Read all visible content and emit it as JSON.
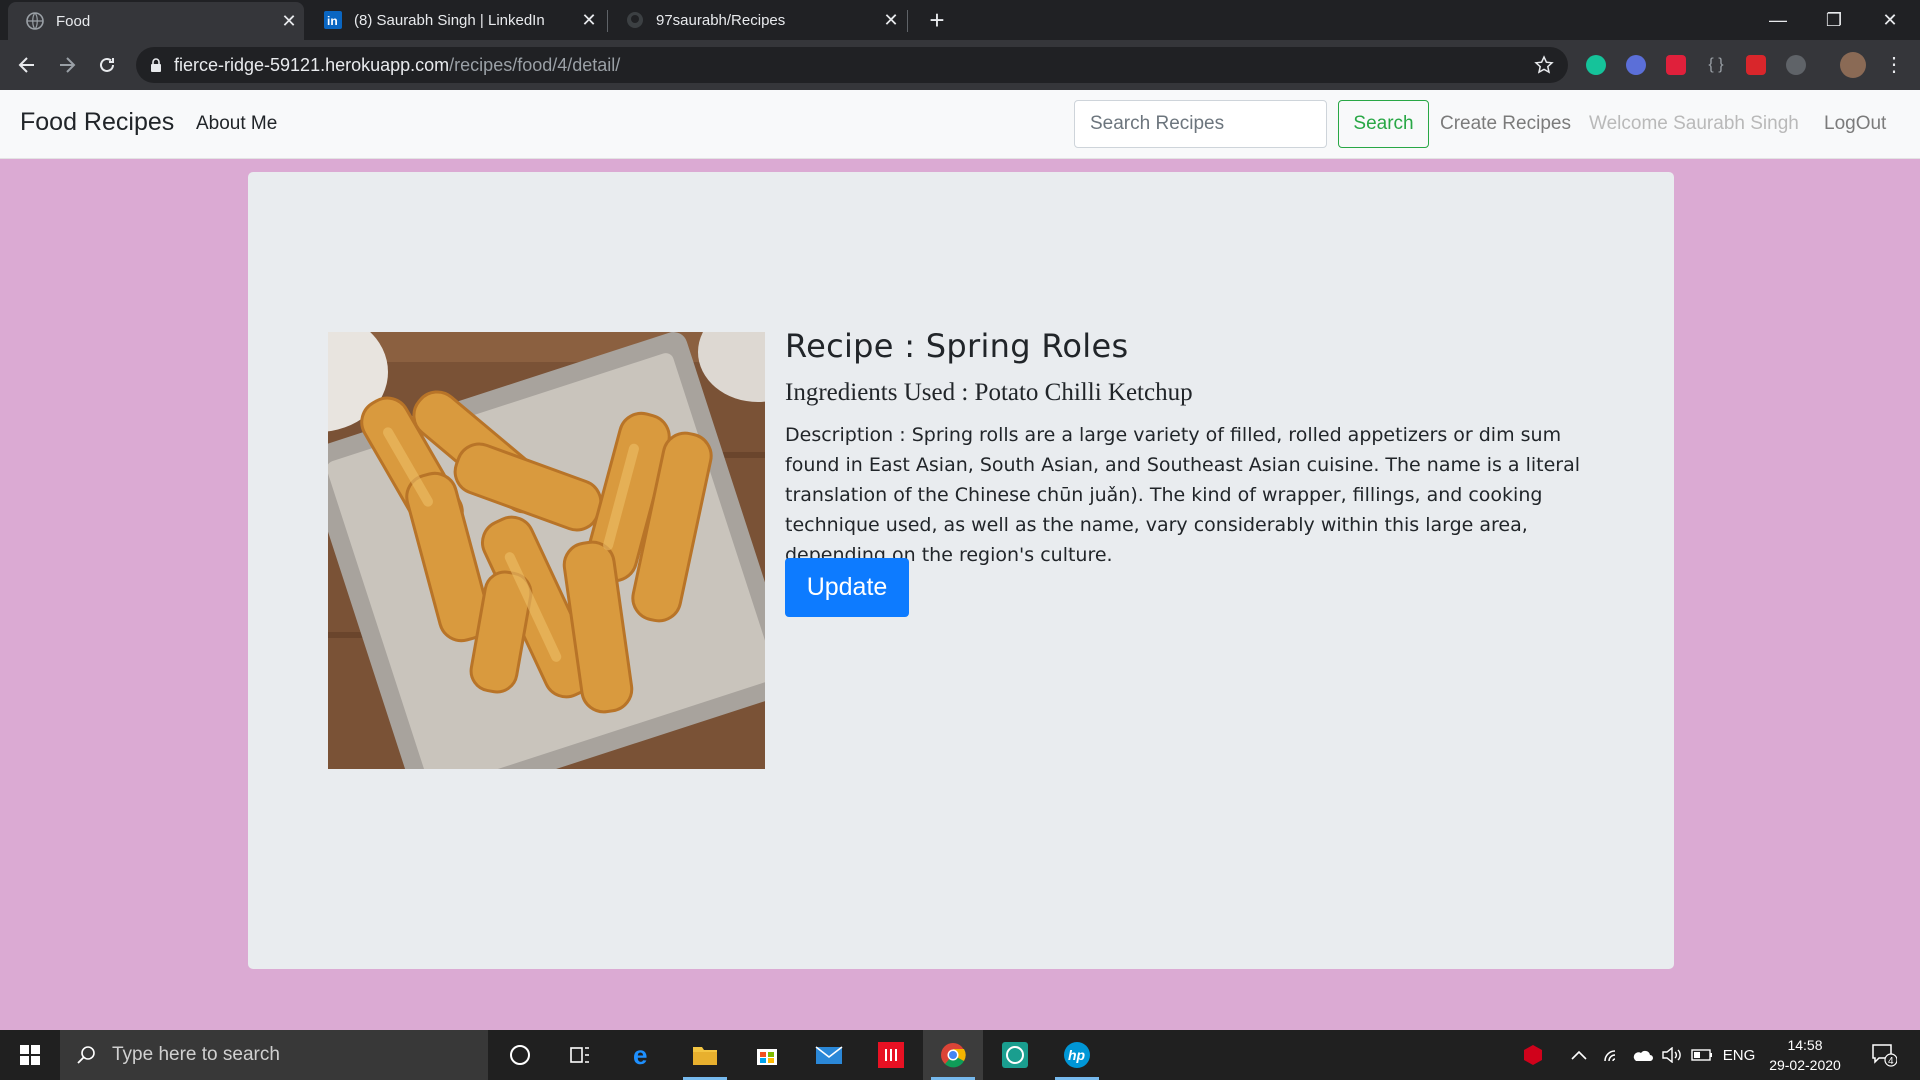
{
  "browser": {
    "tabs": [
      {
        "title": "Food",
        "icon": "globe-icon",
        "active": true
      },
      {
        "title": "(8) Saurabh Singh | LinkedIn",
        "icon": "linkedin-icon",
        "active": false
      },
      {
        "title": "97saurabh/Recipes",
        "icon": "github-icon",
        "active": false
      }
    ],
    "url_host": "fierce-ridge-59121.herokuapp.com",
    "url_path": "/recipes/food/4/detail/"
  },
  "site": {
    "brand": "Food Recipes",
    "about": "About Me",
    "search_placeholder": "Search Recipes",
    "search_button": "Search",
    "create": "Create Recipes",
    "welcome": "Welcome Saurabh Singh",
    "logout": "LogOut"
  },
  "recipe": {
    "title": "Recipe : Spring Roles",
    "ingredients": "Ingredients Used : Potato Chilli Ketchup",
    "description": "Description : Spring rolls are a large variety of filled, rolled appetizers or dim sum found in East Asian, South Asian, and Southeast Asian cuisine. The name is a literal translation of the Chinese chūn juǎn). The kind of wrapper, fillings, and cooking technique used, as well as the name, vary considerably within this large area, depending on the region's culture.",
    "update_button": "Update"
  },
  "taskbar": {
    "search_placeholder": "Type here to search",
    "language": "ENG",
    "time": "14:58",
    "date": "29-02-2020",
    "notification_count": "4"
  },
  "colors": {
    "page_bg": "#dbaad3",
    "card_bg": "#e9ecef",
    "primary": "#0d7bff",
    "success": "#28a745"
  }
}
